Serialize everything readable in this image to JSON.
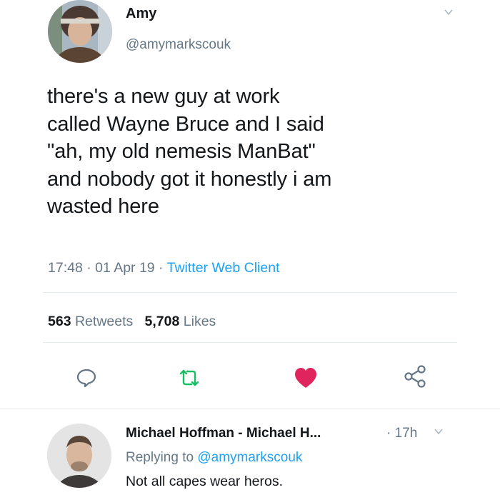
{
  "tweet": {
    "author_name": "Amy",
    "author_handle": "@amymarkscouk",
    "text_lines": [
      "there's a new guy at work",
      "called Wayne Bruce and I said",
      "\"ah, my old nemesis ManBat\"",
      "and nobody got it honestly i am",
      "wasted here"
    ],
    "time": "17:48",
    "date": "01 Apr 19",
    "source": "Twitter Web Client",
    "separator": " · ",
    "retweets_count": "563",
    "retweets_label": "Retweets",
    "likes_count": "5,708",
    "likes_label": "Likes"
  },
  "actions": {
    "reply_icon": "reply-icon",
    "retweet_icon": "retweet-icon",
    "like_icon": "heart-icon",
    "share_icon": "share-icon",
    "like_color": "#e0245e",
    "retweet_color": "#17bf63"
  },
  "reply": {
    "author_name": "Michael Hoffman - Michael H...",
    "time": "· 17h",
    "replying_prefix": "Replying to",
    "replying_handle": "@amymarkscouk",
    "text": "Not all capes wear heros."
  },
  "colors": {
    "link": "#1da1f2",
    "secondary_text": "#657786",
    "primary_text": "#14171a"
  }
}
